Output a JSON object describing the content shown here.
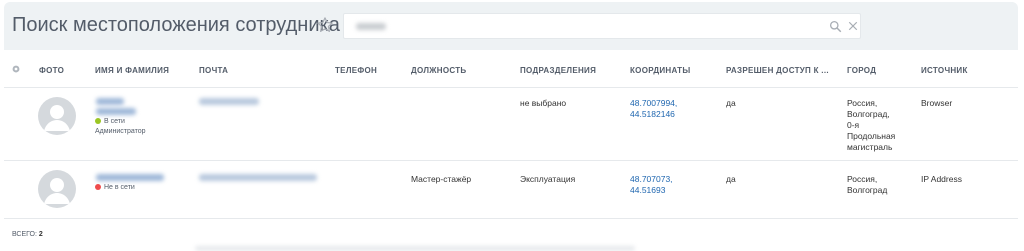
{
  "header": {
    "title": "Поиск местоположения сотрудника",
    "search": {
      "value_hidden": true
    }
  },
  "table": {
    "columns": {
      "photo": "ФОТО",
      "name": "ИМЯ И ФАМИЛИЯ",
      "email": "ПОЧТА",
      "phone": "ТЕЛЕФОН",
      "position": "ДОЛЖНОСТЬ",
      "department": "ПОДРАЗДЕЛЕНИЯ",
      "coords": "КООРДИНАТЫ",
      "access": "РАЗРЕШЕН ДОСТУП К ...",
      "city": "ГОРОД",
      "source": "ИСТОЧНИК"
    },
    "rows": [
      {
        "status": "В сети",
        "status_color": "#9bc623",
        "role": "Администратор",
        "position": "",
        "department": "не выбрано",
        "coords_line1": "48.7007994,",
        "coords_line2": "44.5182146",
        "access": "да",
        "city_lines": [
          "Россия,",
          "Волгоград,",
          "0-я",
          "Продольная",
          "магистраль"
        ],
        "source": "Browser"
      },
      {
        "status": "Не в сети",
        "status_color": "#ef4b4b",
        "role": "",
        "position": "Мастер-стажёр",
        "department": "Эксплуатация",
        "coords_line1": "48.707073,",
        "coords_line2": "44.51693",
        "access": "да",
        "city_lines": [
          "Россия,",
          "Волгоград"
        ],
        "source": "IP Address"
      }
    ]
  },
  "footer": {
    "total_label": "ВСЕГО:",
    "total_value": "2"
  },
  "colors": {
    "header_bg": "#eef2f4",
    "link": "#2067b0",
    "online": "#9bc623",
    "offline": "#ef4b4b"
  }
}
